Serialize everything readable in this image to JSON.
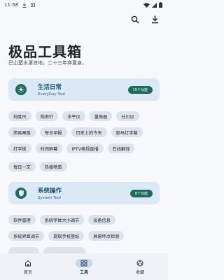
{
  "status_bar": {
    "time": "11:58"
  },
  "header": {
    "title": "极品工具箱",
    "subtitle": "巴山楚水凄凉地，二十三年弃置身。"
  },
  "categories": [
    {
      "name": "生活日常",
      "en": "EveryDay Tool",
      "badge": "15个功能",
      "rows": [
        [
          "刻度尺",
          "指南针",
          "水平仪",
          "量角器",
          "分贝仪"
        ],
        [
          "简易画板",
          "每日早报",
          "历史上的今天",
          "跑马灯字幕"
        ],
        [
          "打字板",
          "时间屏幕",
          "IPTV电视直播",
          "在线翻译"
        ],
        [
          "每日一文",
          "热搜榜单"
        ]
      ]
    },
    {
      "name": "系统操作",
      "en": "System Tool",
      "badge": "8个功能",
      "rows": [
        [
          "软件管理",
          "系统字体大小调节",
          "设备信息"
        ],
        [
          "系统界面调节",
          "提取手机壁纸",
          "屏幕坏点检测"
        ],
        [
          "",
          ""
        ]
      ]
    }
  ],
  "bottom_nav": [
    {
      "label": "首页",
      "icon": "home-icon",
      "active": false
    },
    {
      "label": "工具",
      "icon": "grid-icon",
      "active": true
    },
    {
      "label": "收藏",
      "icon": "favorite-icon",
      "active": false
    }
  ],
  "colors": {
    "card_bg": "#dbe8f6",
    "accent": "#1e6b5e",
    "chip_bg": "#dde3eb",
    "page_bg": "#f6f8fb"
  }
}
